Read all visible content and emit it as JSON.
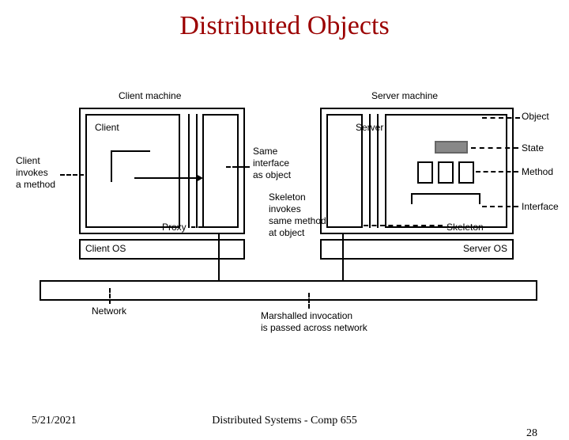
{
  "title": "Distributed Objects",
  "labels": {
    "client_machine": "Client machine",
    "server_machine": "Server machine",
    "client": "Client",
    "server": "Server",
    "object": "Object",
    "state": "State",
    "method": "Method",
    "interface": "Interface",
    "client_invokes": "Client\ninvokes\na method",
    "same_iface": "Same\ninterface\nas object",
    "skeleton_invokes": "Skeleton\ninvokes\nsame method\nat object",
    "proxy": "Proxy",
    "skeleton": "Skeleton",
    "client_os": "Client OS",
    "server_os": "Server OS",
    "network": "Network",
    "marshalled": "Marshalled invocation\nis passed across network"
  },
  "footer": {
    "date": "5/21/2021",
    "course": "Distributed Systems - Comp 655",
    "page": "28"
  }
}
